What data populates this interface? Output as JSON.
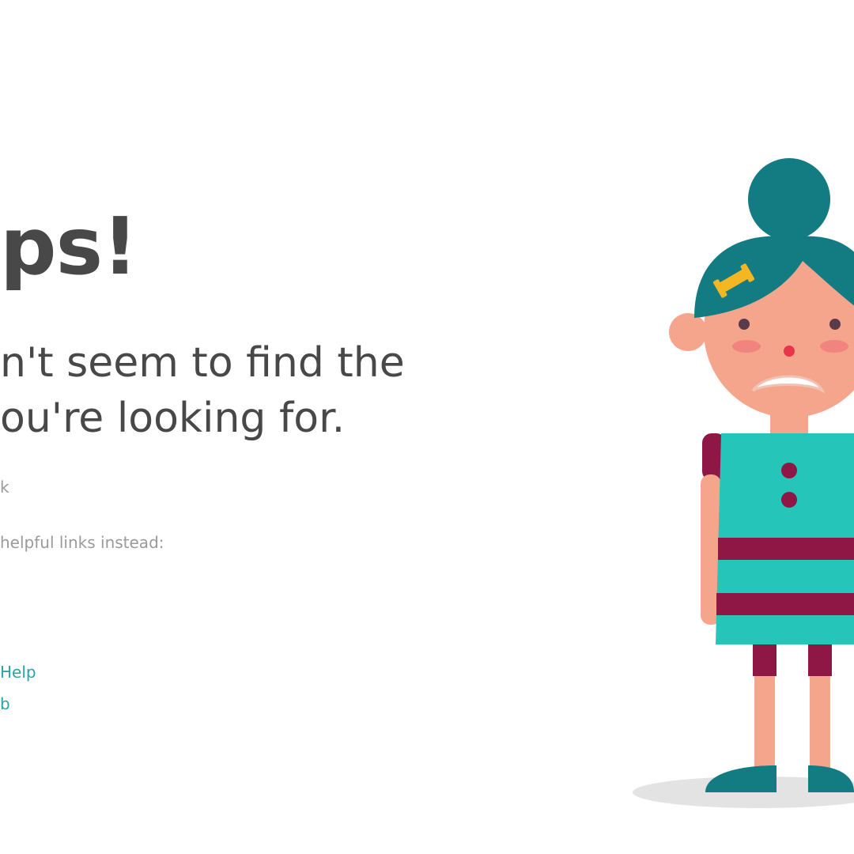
{
  "headline": "ps!",
  "message": {
    "line1": "n't seem to find the",
    "line2": "ou're looking for."
  },
  "error_code": "k",
  "helpful_text": "helpful links instead:",
  "links": [
    {
      "label": "Help"
    },
    {
      "label": "b"
    }
  ],
  "illustration": {
    "colors": {
      "hair": "#137b82",
      "skin": "#f5a58c",
      "dress": "#25c5b9",
      "stripe": "#8e1746",
      "barrette": "#f5b623",
      "shadow": "#e3e3e3"
    }
  }
}
